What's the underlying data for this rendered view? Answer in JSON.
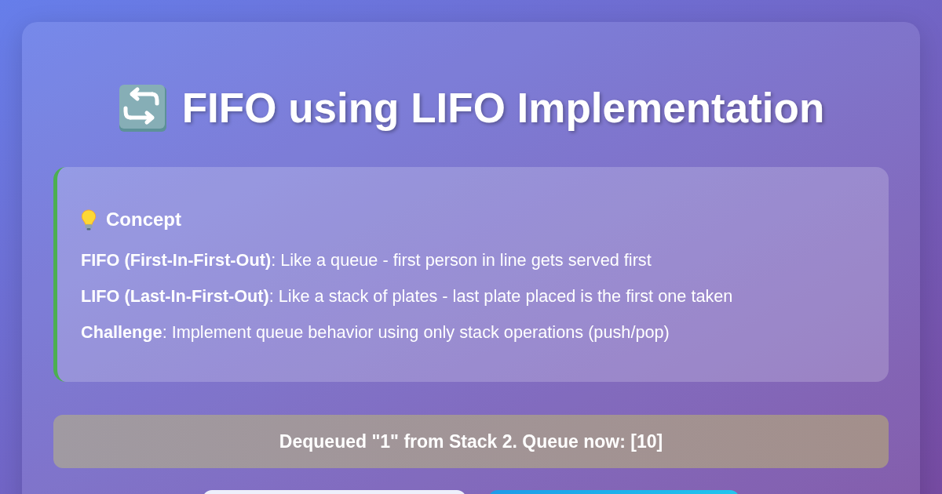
{
  "title": "FIFO using LIFO Implementation",
  "concept": {
    "heading": "Concept",
    "lines": [
      "**FIFO (First-In-First-Out)**: Like a queue - first person in line gets served first",
      "**LIFO (Last-In-First-Out)**: Like a stack of plates - last plate placed is the first one taken",
      "**Challenge**: Implement queue behavior using only stack operations (push/pop)"
    ]
  },
  "status_message": "Dequeued \"1\" from Stack 2. Queue now: [10]",
  "buttons": [
    {
      "kind": "secondary"
    },
    {
      "kind": "primary"
    }
  ]
}
